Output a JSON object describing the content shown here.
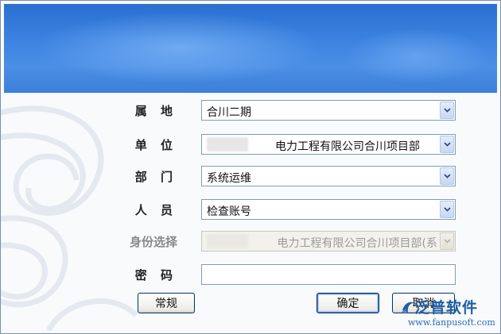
{
  "form": {
    "affiliation": {
      "label": "属 地",
      "value": "合川二期"
    },
    "unit": {
      "label": "单 位",
      "value": "电力工程有限公司合川项目部"
    },
    "department": {
      "label": "部 门",
      "value": "系统运维"
    },
    "person": {
      "label": "人 员",
      "value": "检查账号"
    },
    "identity": {
      "label": "身份选择",
      "value": "电力工程有限公司合川项目部(系"
    },
    "password": {
      "label": "密 码",
      "value": ""
    }
  },
  "buttons": {
    "general": "常规",
    "ok": "确定",
    "cancel": "取消"
  },
  "watermark": {
    "brand": "泛普软件",
    "url": "www.fanpusoft.com"
  }
}
